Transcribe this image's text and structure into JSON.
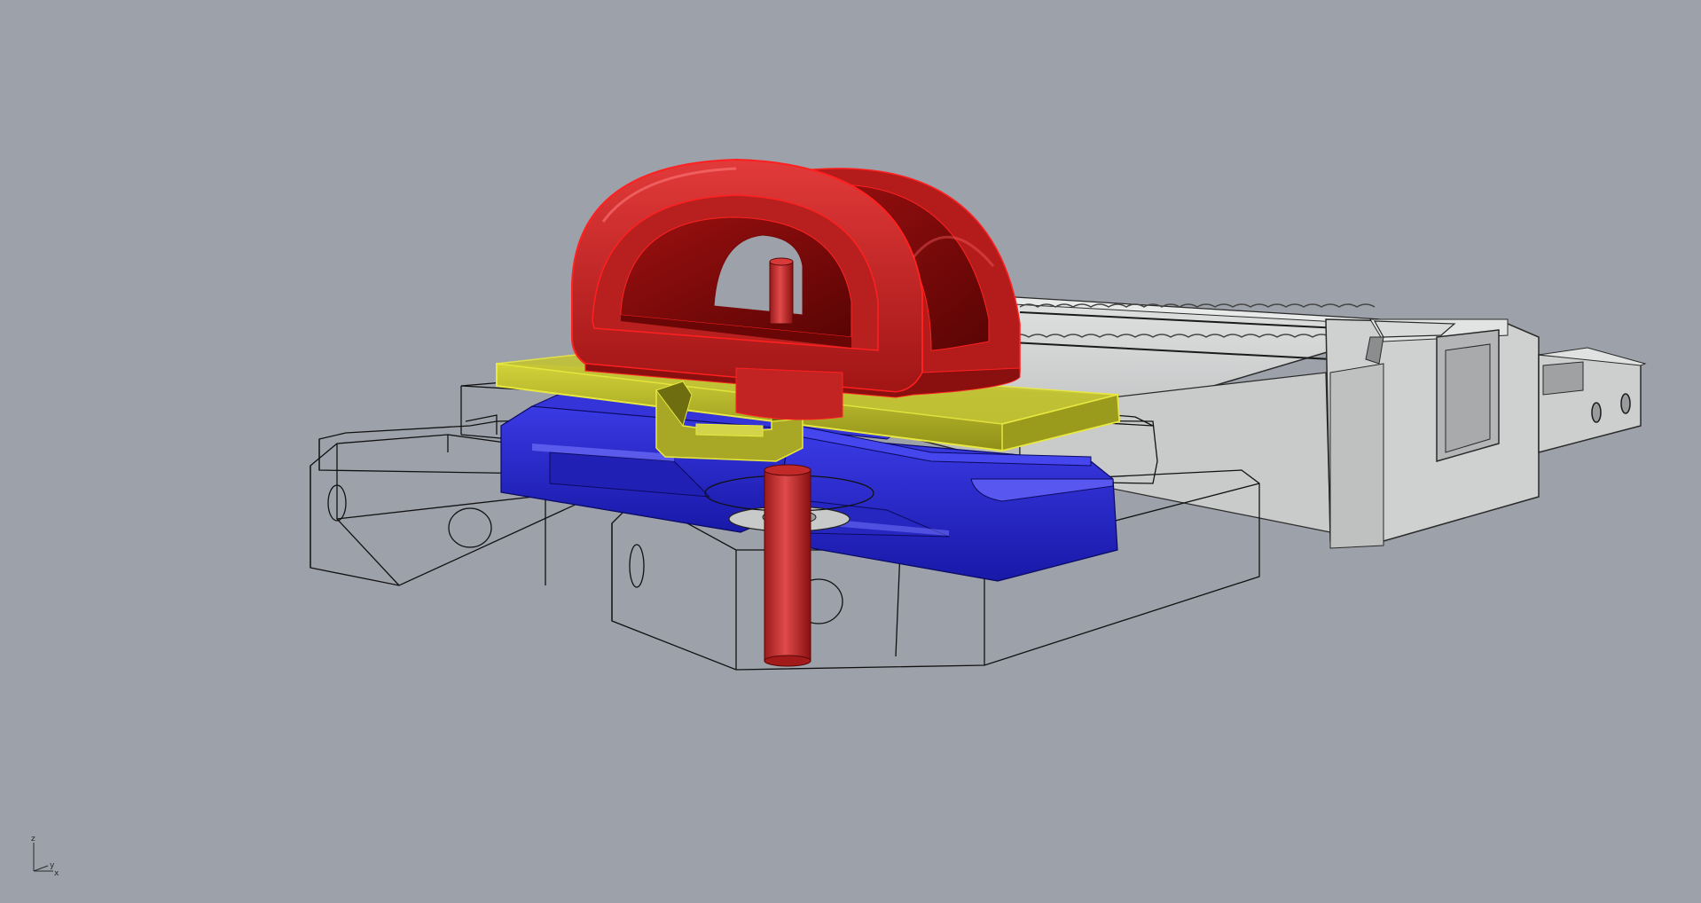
{
  "viewport": {
    "background_color": "#9da1aa",
    "display_mode": "shaded"
  },
  "axis_indicator": {
    "z_label": "z",
    "y_label": "y",
    "x_label": "x"
  },
  "colors": {
    "red_part": "#d42a2a",
    "yellow_part": "#c8c834",
    "blue_part": "#2a2ad0",
    "gray_part": "#d2d3d3",
    "wireframe": "#111111"
  },
  "objects": [
    {
      "name": "handle-red"
    },
    {
      "name": "shaft-red"
    },
    {
      "name": "plate-yellow"
    },
    {
      "name": "clamp-blue"
    },
    {
      "name": "base-wireframe"
    },
    {
      "name": "rail-gray"
    }
  ]
}
